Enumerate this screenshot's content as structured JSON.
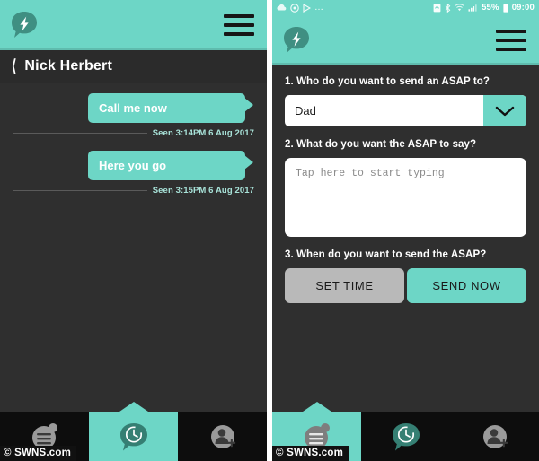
{
  "app": {
    "brand_teal": "#6dd6c6",
    "dark_bg": "#2f2f2f",
    "nav_bg": "#0d0d0d",
    "logo_icon": "lightning-speech-bubble-icon",
    "menu_icon": "hamburger-menu-icon",
    "watermark": "© SWNS.com"
  },
  "left_screen": {
    "conversation": {
      "back_icon": "back-chevron-icon",
      "contact_name": "Nick Herbert",
      "messages": [
        {
          "text": "Call me now",
          "status": "Seen 3:14PM 6 Aug 2017"
        },
        {
          "text": "Here you go",
          "status": "Seen 3:15PM 6 Aug 2017"
        }
      ]
    },
    "bottom_nav": [
      {
        "id": "feed",
        "icon": "list-feed-badge-icon",
        "active": false
      },
      {
        "id": "asap",
        "icon": "chat-clock-icon",
        "active": true
      },
      {
        "id": "contacts",
        "icon": "add-person-icon",
        "active": false
      }
    ]
  },
  "right_screen": {
    "status_bar": {
      "left_icons": [
        "cloud-icon",
        "record-icon",
        "play-icon"
      ],
      "overflow": "…",
      "right_icons": [
        "sync-icon",
        "bluetooth-icon",
        "wifi-icon",
        "signal-bars-icon",
        "battery-icon"
      ],
      "battery_percent": "55%",
      "clock": "09:00"
    },
    "form": {
      "questions": [
        {
          "number": "1.",
          "label": "1. Who do you want to send an ASAP to?",
          "type": "select",
          "value": "Dad",
          "arrow_icon": "chevron-down-icon"
        },
        {
          "number": "2.",
          "label": "2. What do you want the ASAP to say?",
          "type": "textarea",
          "placeholder": "Tap here to start typing",
          "value": ""
        },
        {
          "number": "3.",
          "label": "3. When do you want to send the ASAP?",
          "type": "buttons",
          "buttons": [
            {
              "id": "set-time",
              "label": "SET TIME",
              "style": "grey"
            },
            {
              "id": "send-now",
              "label": "SEND NOW",
              "style": "teal"
            }
          ]
        }
      ]
    },
    "bottom_nav": [
      {
        "id": "feed",
        "icon": "list-feed-badge-icon",
        "active": true
      },
      {
        "id": "asap",
        "icon": "chat-clock-icon",
        "active": false
      },
      {
        "id": "contacts",
        "icon": "add-person-icon",
        "active": false
      }
    ]
  }
}
